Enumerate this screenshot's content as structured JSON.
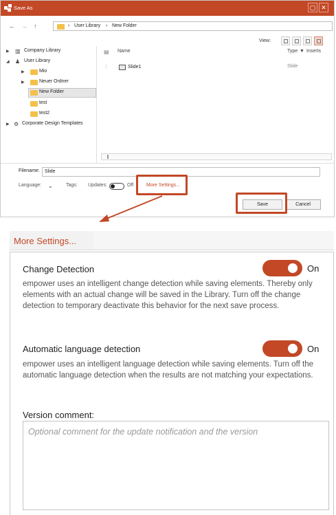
{
  "dialog": {
    "title": "Save As",
    "nav": {
      "back": "←",
      "forward": "→",
      "up": "↑"
    },
    "breadcrumb": [
      "User Library",
      "New Folder"
    ],
    "breadcrumb_sep": "›",
    "view_label": "View:",
    "tree": [
      {
        "label": "Company Library",
        "expander": "▶",
        "icon": "library-icon"
      },
      {
        "label": "User Library",
        "expander": "◢",
        "icon": "user-library-icon"
      },
      {
        "label": "Mio",
        "expander": "▶",
        "icon": "folder-icon"
      },
      {
        "label": "Neuer Ordner",
        "expander": "▶",
        "icon": "folder-icon"
      },
      {
        "label": "New Folder",
        "expander": "",
        "icon": "folder-icon",
        "selected": true
      },
      {
        "label": "test",
        "expander": "",
        "icon": "folder-icon"
      },
      {
        "label": "test2",
        "expander": "",
        "icon": "folder-icon"
      },
      {
        "label": "Corporate Design Templates",
        "expander": "▶",
        "icon": "templates-icon"
      }
    ],
    "columns": {
      "name": "Name",
      "type": "Type",
      "inserts": "Inserts"
    },
    "files": [
      {
        "name": "Slide1",
        "type": "Slide"
      }
    ],
    "filename_label": "Filename:",
    "filename_value": "Slide",
    "language_label": "Language:",
    "tags_label": "Tags:",
    "updates_label": "Updates:",
    "updates_state": "Off",
    "more_settings": "More Settings...",
    "save_button": "Save",
    "cancel_button": "Cancel"
  },
  "more_settings_panel": {
    "header": "More Settings...",
    "change_detection": {
      "title": "Change Detection",
      "state": "On",
      "description": "empower uses an intelligent change detection while saving elements. Thereby only elements with an actual change will be saved in the Library. Turn off the change detection to temporary deactivate this behavior for the next save process."
    },
    "language_detection": {
      "title": "Automatic language detection",
      "state": "On",
      "description": "empower uses an intelligent language detection while saving elements. Turn off the automatic language detection when the results are not matching your expectations."
    },
    "version_comment": {
      "label": "Version comment:",
      "placeholder": "Optional comment for the update notification and the version"
    }
  },
  "colors": {
    "accent": "#c24826",
    "toggle_on": "#c24826"
  }
}
